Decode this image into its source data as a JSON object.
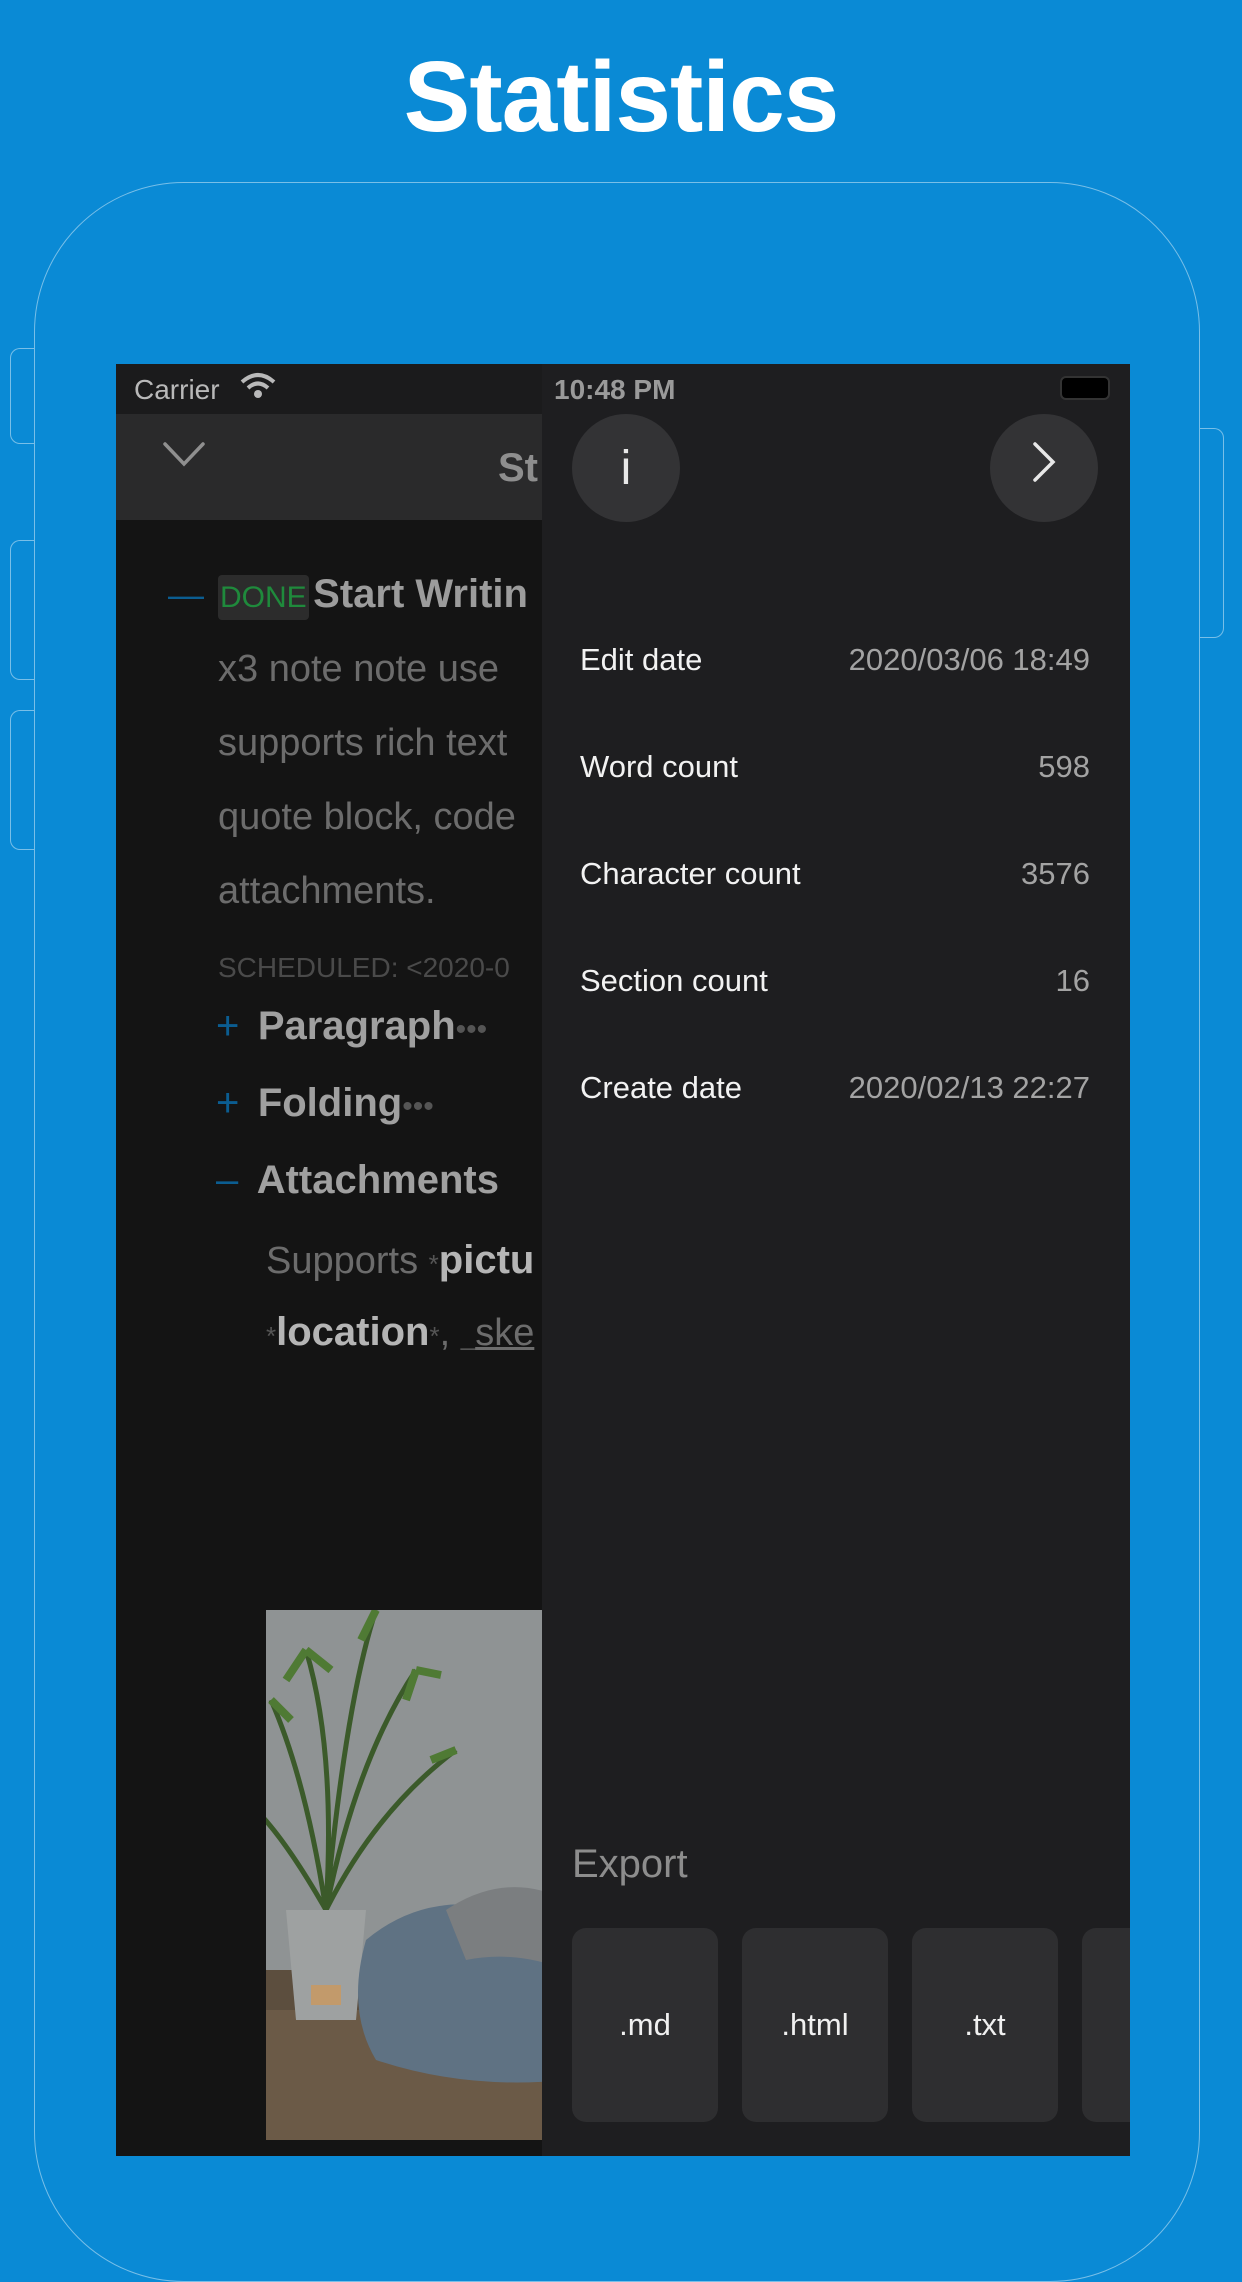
{
  "hero_title": "Statistics",
  "status": {
    "carrier": "Carrier",
    "time": "10:48 PM"
  },
  "nav": {
    "title_partial": "St"
  },
  "note": {
    "done_tag": "DONE",
    "heading": "Start Writin",
    "lines": [
      "x3 note note use",
      "supports rich text",
      "quote block, code",
      "attachments."
    ],
    "scheduled": "SCHEDULED: <2020-0",
    "sections": [
      {
        "toggle": "+",
        "label": "Paragraph",
        "ellipsis": "•••"
      },
      {
        "toggle": "+",
        "label": "Folding",
        "ellipsis": "•••"
      },
      {
        "toggle": "–",
        "label": "Attachments",
        "ellipsis": ""
      }
    ],
    "attach_line1_plain": "Supports ",
    "attach_line1_mark": "*",
    "attach_line1_bold": "pictu",
    "attach_line2_mark": "*",
    "attach_line2_bold": "location",
    "attach_line2_mark_end": "*",
    "attach_line2_sep": ", ",
    "attach_line2_u_mark": "_",
    "attach_line2_link": "ske"
  },
  "panel": {
    "info_label": "i",
    "stats": [
      {
        "key": "Edit date",
        "value": "2020/03/06 18:49"
      },
      {
        "key": "Word count",
        "value": "598"
      },
      {
        "key": "Character count",
        "value": "3576"
      },
      {
        "key": "Section count",
        "value": "16"
      },
      {
        "key": "Create date",
        "value": "2020/02/13 22:27"
      }
    ],
    "export_label": "Export",
    "export_buttons": [
      ".md",
      ".html",
      ".txt"
    ]
  },
  "colors": {
    "background": "#0a8ad5",
    "panel": "#1e1e20",
    "accent": "#0b5d91",
    "done": "#1f8a3c"
  }
}
